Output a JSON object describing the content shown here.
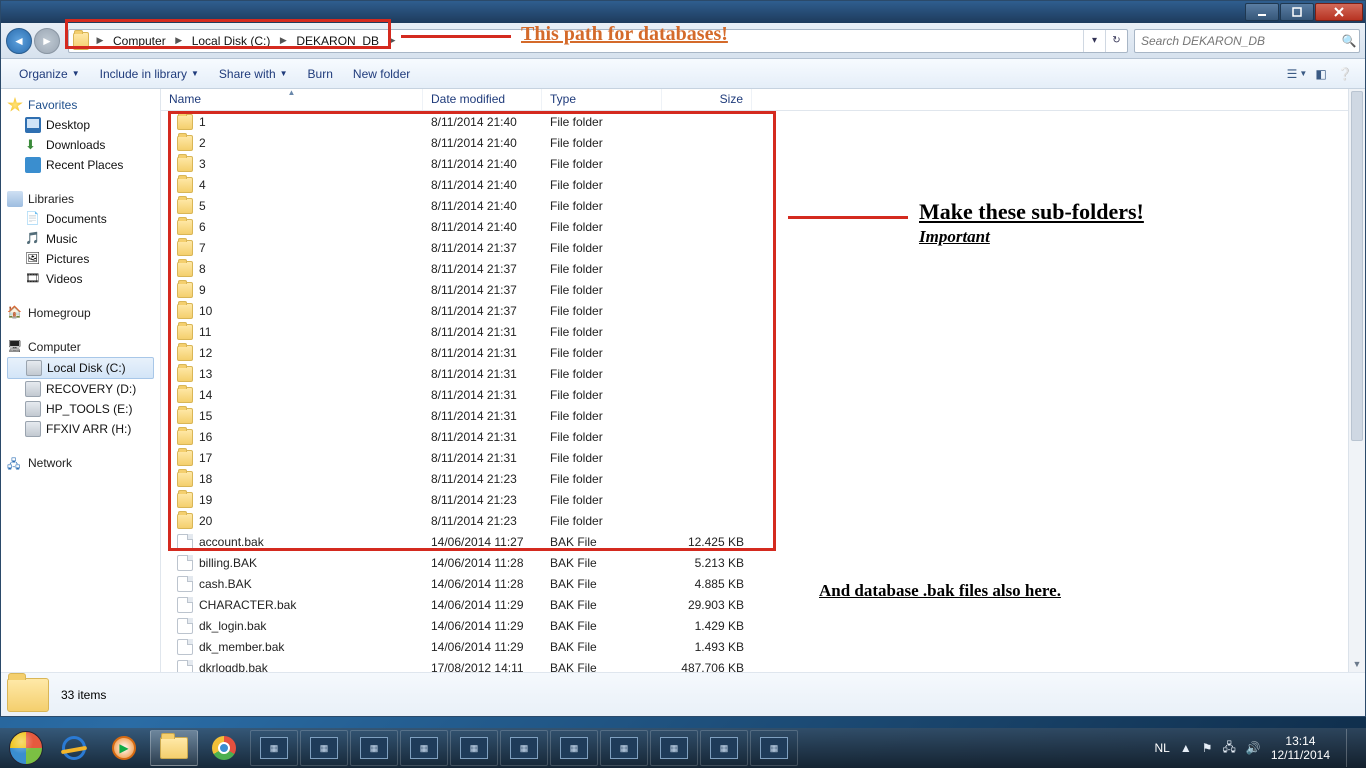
{
  "breadcrumbs": [
    "Computer",
    "Local Disk (C:)",
    "DEKARON_DB"
  ],
  "search_placeholder": "Search DEKARON_DB",
  "toolbar": {
    "organize": "Organize",
    "include": "Include in library",
    "share": "Share with",
    "burn": "Burn",
    "newfolder": "New folder"
  },
  "sidebar": {
    "favorites": "Favorites",
    "fav_items": [
      "Desktop",
      "Downloads",
      "Recent Places"
    ],
    "libraries": "Libraries",
    "lib_items": [
      "Documents",
      "Music",
      "Pictures",
      "Videos"
    ],
    "homegroup": "Homegroup",
    "computer": "Computer",
    "drives": [
      "Local Disk (C:)",
      "RECOVERY (D:)",
      "HP_TOOLS (E:)",
      "FFXIV ARR (H:)"
    ],
    "network": "Network"
  },
  "columns": {
    "name": "Name",
    "date": "Date modified",
    "type": "Type",
    "size": "Size"
  },
  "rows": [
    {
      "n": "1",
      "d": "8/11/2014 21:40",
      "t": "File folder",
      "s": "",
      "k": "folder"
    },
    {
      "n": "2",
      "d": "8/11/2014 21:40",
      "t": "File folder",
      "s": "",
      "k": "folder"
    },
    {
      "n": "3",
      "d": "8/11/2014 21:40",
      "t": "File folder",
      "s": "",
      "k": "folder"
    },
    {
      "n": "4",
      "d": "8/11/2014 21:40",
      "t": "File folder",
      "s": "",
      "k": "folder"
    },
    {
      "n": "5",
      "d": "8/11/2014 21:40",
      "t": "File folder",
      "s": "",
      "k": "folder"
    },
    {
      "n": "6",
      "d": "8/11/2014 21:40",
      "t": "File folder",
      "s": "",
      "k": "folder"
    },
    {
      "n": "7",
      "d": "8/11/2014 21:37",
      "t": "File folder",
      "s": "",
      "k": "folder"
    },
    {
      "n": "8",
      "d": "8/11/2014 21:37",
      "t": "File folder",
      "s": "",
      "k": "folder"
    },
    {
      "n": "9",
      "d": "8/11/2014 21:37",
      "t": "File folder",
      "s": "",
      "k": "folder"
    },
    {
      "n": "10",
      "d": "8/11/2014 21:37",
      "t": "File folder",
      "s": "",
      "k": "folder"
    },
    {
      "n": "11",
      "d": "8/11/2014 21:31",
      "t": "File folder",
      "s": "",
      "k": "folder"
    },
    {
      "n": "12",
      "d": "8/11/2014 21:31",
      "t": "File folder",
      "s": "",
      "k": "folder"
    },
    {
      "n": "13",
      "d": "8/11/2014 21:31",
      "t": "File folder",
      "s": "",
      "k": "folder"
    },
    {
      "n": "14",
      "d": "8/11/2014 21:31",
      "t": "File folder",
      "s": "",
      "k": "folder"
    },
    {
      "n": "15",
      "d": "8/11/2014 21:31",
      "t": "File folder",
      "s": "",
      "k": "folder"
    },
    {
      "n": "16",
      "d": "8/11/2014 21:31",
      "t": "File folder",
      "s": "",
      "k": "folder"
    },
    {
      "n": "17",
      "d": "8/11/2014 21:31",
      "t": "File folder",
      "s": "",
      "k": "folder"
    },
    {
      "n": "18",
      "d": "8/11/2014 21:23",
      "t": "File folder",
      "s": "",
      "k": "folder"
    },
    {
      "n": "19",
      "d": "8/11/2014 21:23",
      "t": "File folder",
      "s": "",
      "k": "folder"
    },
    {
      "n": "20",
      "d": "8/11/2014 21:23",
      "t": "File folder",
      "s": "",
      "k": "folder"
    },
    {
      "n": "account.bak",
      "d": "14/06/2014 11:27",
      "t": "BAK File",
      "s": "12.425 KB",
      "k": "file"
    },
    {
      "n": "billing.BAK",
      "d": "14/06/2014 11:28",
      "t": "BAK File",
      "s": "5.213 KB",
      "k": "file"
    },
    {
      "n": "cash.BAK",
      "d": "14/06/2014 11:28",
      "t": "BAK File",
      "s": "4.885 KB",
      "k": "file"
    },
    {
      "n": "CHARACTER.bak",
      "d": "14/06/2014 11:29",
      "t": "BAK File",
      "s": "29.903 KB",
      "k": "file"
    },
    {
      "n": "dk_login.bak",
      "d": "14/06/2014 11:29",
      "t": "BAK File",
      "s": "1.429 KB",
      "k": "file"
    },
    {
      "n": "dk_member.bak",
      "d": "14/06/2014 11:29",
      "t": "BAK File",
      "s": "1.493 KB",
      "k": "file"
    },
    {
      "n": "dkrlogdb.bak",
      "d": "17/08/2012 14:11",
      "t": "BAK File",
      "s": "487.706 KB",
      "k": "file"
    }
  ],
  "status": {
    "count": "33 items"
  },
  "annotations": {
    "path_label": "This path for databases!",
    "sub_head": "Make these sub-folders!",
    "sub_sub": "Important",
    "bak_note": "And database .bak files also here."
  },
  "tray": {
    "lang": "NL",
    "time": "13:14",
    "date": "12/11/2014"
  }
}
